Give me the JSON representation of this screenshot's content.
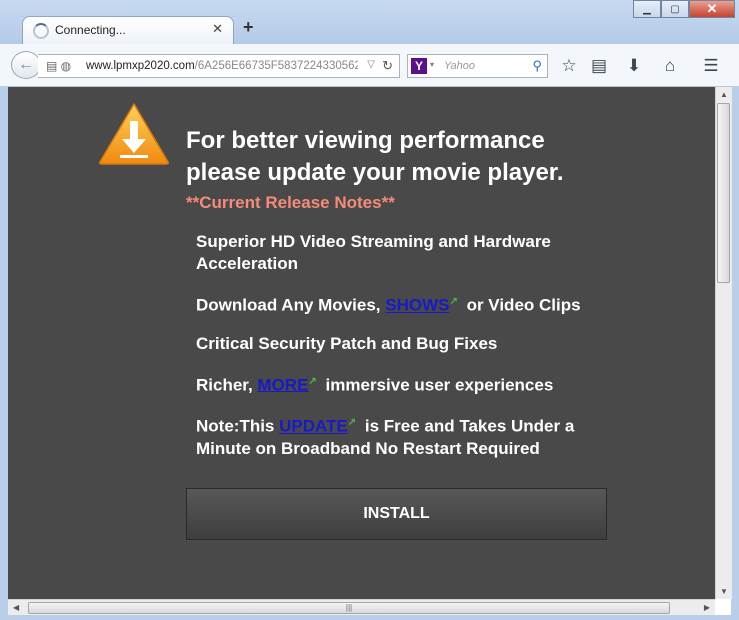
{
  "tab": {
    "title": "Connecting...",
    "close": "✕",
    "new_tab": "+"
  },
  "window": {
    "minimize": "▁",
    "maximize": "▢",
    "close": "✕"
  },
  "nav": {
    "url_host": "www.lpmxp2020.com",
    "url_path": "/6A256E66735F5837224330562",
    "search_placeholder": "Yahoo",
    "search_engine_logo": "Y"
  },
  "content": {
    "headline": "For better viewing performance please update your movie player.",
    "release_notes": "**Current Release Notes**",
    "features": [
      {
        "text": "Superior HD Video Streaming and Hardware Acceleration"
      },
      {
        "before": "Download Any Movies, ",
        "link": "SHOWS",
        "after": " or Video Clips"
      },
      {
        "text": "Critical Security Patch and Bug Fixes"
      },
      {
        "before": "Richer, ",
        "link": "MORE",
        "after": " immersive user experiences"
      },
      {
        "before": "Note:This ",
        "link": "UPDATE",
        "after": " is Free and Takes Under a Minute on Broadband No Restart Required"
      }
    ],
    "install_label": "INSTALL"
  },
  "colors": {
    "page_bg": "#494949",
    "release_notes": "#f58b7a",
    "link": "#1919c8",
    "warning_icon": "#f7a11a"
  }
}
